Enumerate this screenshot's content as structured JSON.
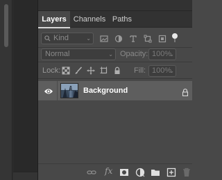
{
  "tabs": [
    {
      "label": "Layers",
      "active": true
    },
    {
      "label": "Channels",
      "active": false
    },
    {
      "label": "Paths",
      "active": false
    }
  ],
  "filter": {
    "kind_label": "Kind",
    "icons": [
      "pixel-filter-icon",
      "adjustment-filter-icon",
      "type-filter-icon",
      "shape-filter-icon",
      "smart-object-filter-icon",
      "filter-toggle-icon"
    ]
  },
  "blend": {
    "mode": "Normal",
    "opacity_label": "Opacity:",
    "opacity_value": "100%"
  },
  "lock": {
    "label": "Lock:",
    "icons": [
      "lock-transparent-icon",
      "lock-image-icon",
      "lock-position-icon",
      "lock-artboard-icon",
      "lock-all-icon"
    ],
    "fill_label": "Fill:",
    "fill_value": "100%"
  },
  "layers": [
    {
      "name": "Background",
      "visible": true,
      "locked": true
    }
  ],
  "bottom_toolbar": {
    "fx_label": "fx",
    "icons": [
      "link-layers-icon",
      "layer-style-icon",
      "add-mask-icon",
      "adjustment-layer-icon",
      "new-group-icon",
      "new-layer-icon",
      "delete-layer-icon"
    ]
  },
  "colors": {
    "panel_bg": "#484848",
    "tabbar_bg": "#323232",
    "selected_layer_bg": "#5e5e5e",
    "canvas_bg": "#292929"
  }
}
